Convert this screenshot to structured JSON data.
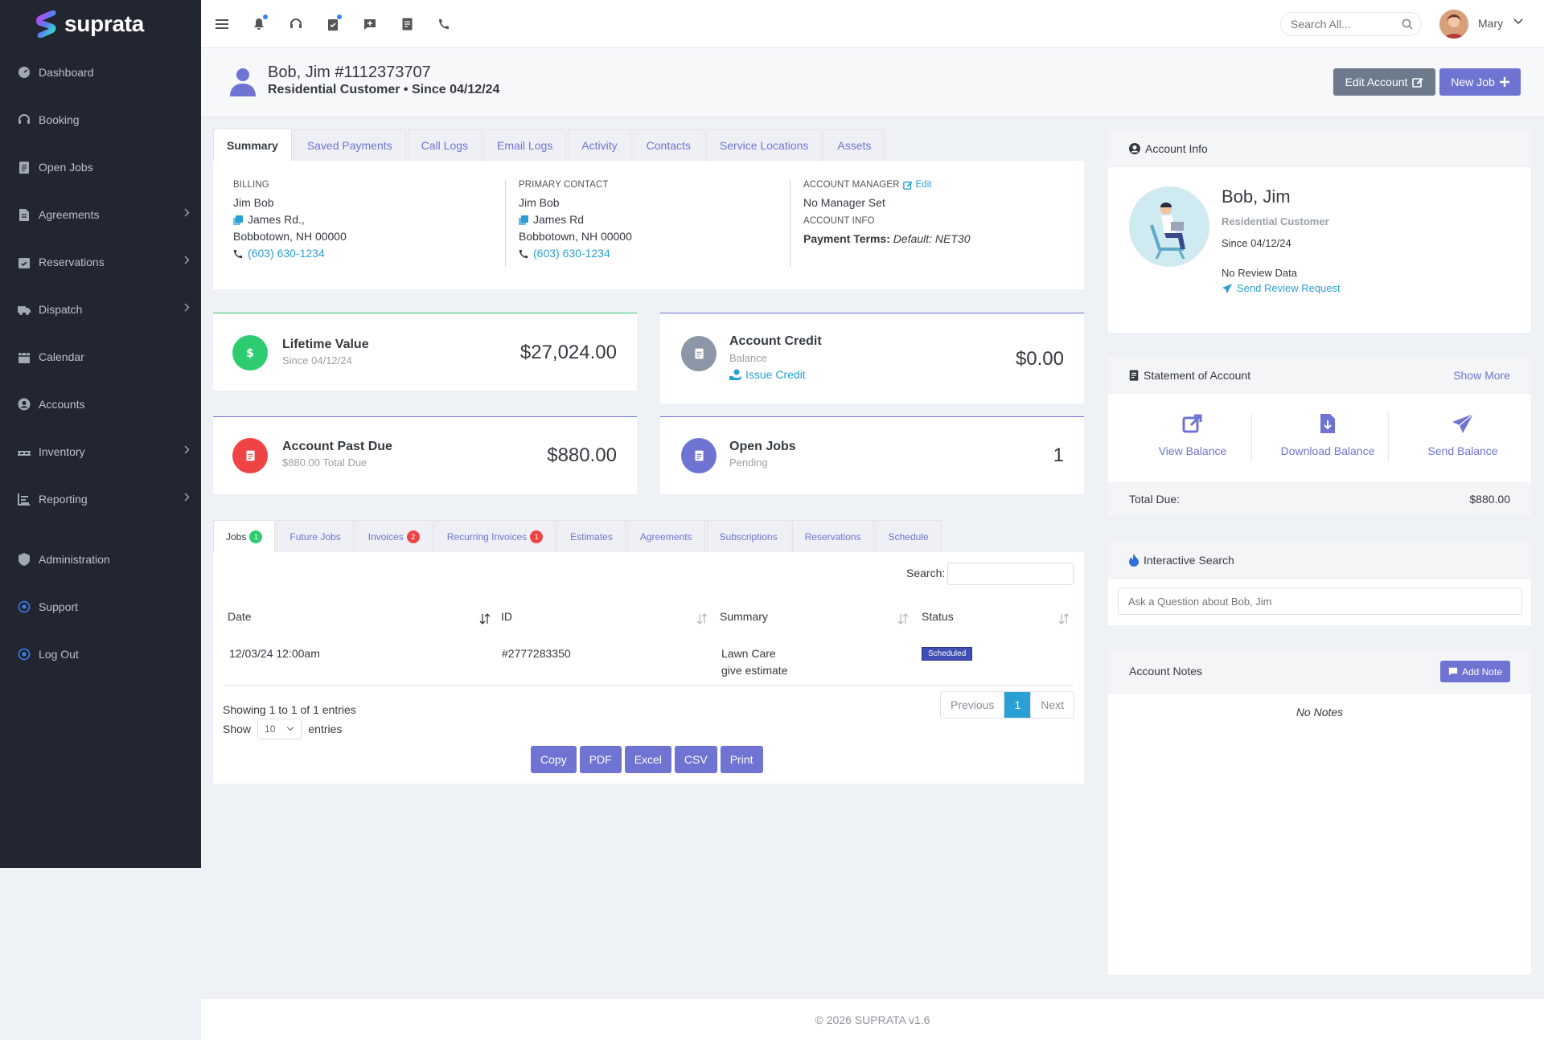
{
  "app": {
    "logo_text": "suprata",
    "footer": "© 2026 SUPRATA v1.6"
  },
  "sidebar": {
    "items": [
      {
        "label": "Dashboard",
        "icon": "dashboard-icon",
        "has_children": false
      },
      {
        "label": "Booking",
        "icon": "headset-icon",
        "has_children": false
      },
      {
        "label": "Open Jobs",
        "icon": "clipboard-icon",
        "has_children": false
      },
      {
        "label": "Agreements",
        "icon": "file-contract-icon",
        "has_children": true
      },
      {
        "label": "Reservations",
        "icon": "calendar-check-icon",
        "has_children": true
      },
      {
        "label": "Dispatch",
        "icon": "truck-icon",
        "has_children": true
      },
      {
        "label": "Calendar",
        "icon": "calendar-icon",
        "has_children": false
      },
      {
        "label": "Accounts",
        "icon": "user-circle-icon",
        "has_children": false
      },
      {
        "label": "Inventory",
        "icon": "pallet-icon",
        "has_children": true
      },
      {
        "label": "Reporting",
        "icon": "chart-icon",
        "has_children": true
      }
    ],
    "bottom_items": [
      {
        "label": "Administration",
        "icon": "shield-icon"
      },
      {
        "label": "Support",
        "icon": "support-icon"
      },
      {
        "label": "Log Out",
        "icon": "logout-icon"
      }
    ]
  },
  "topbar": {
    "search_placeholder": "Search All...",
    "user_name": "Mary"
  },
  "header": {
    "title": "Bob, Jim #1112373707",
    "subtitle": "Residential Customer • Since 04/12/24",
    "edit_button": "Edit Account",
    "new_job_button": "New Job"
  },
  "summary_tabs": [
    "Summary",
    "Saved Payments",
    "Call Logs",
    "Email Logs",
    "Activity",
    "Contacts",
    "Service Locations",
    "Assets"
  ],
  "summary_active_tab": "Summary",
  "billing": {
    "label": "BILLING",
    "name": "Jim Bob",
    "street": "James Rd.,",
    "city": "Bobbotown, NH 00000",
    "phone": "(603) 630-1234"
  },
  "primary_contact": {
    "label": "PRIMARY CONTACT",
    "name": "Jim Bob",
    "street": "James Rd",
    "city": "Bobbotown, NH 00000",
    "phone": "(603) 630-1234"
  },
  "account_manager": {
    "label": "ACCOUNT MANAGER",
    "edit_label": "Edit",
    "value": "No Manager Set",
    "info_label": "ACCOUNT INFO",
    "terms_label": "Payment Terms:",
    "terms_value": "Default: NET30"
  },
  "stats": {
    "lifetime": {
      "title": "Lifetime Value",
      "sub": "Since 04/12/24",
      "value": "$27,024.00",
      "color": "#2ecc71"
    },
    "credit": {
      "title": "Account Credit",
      "sub": "Balance",
      "link": "Issue Credit",
      "value": "$0.00",
      "color": "#8b96a6"
    },
    "past_due": {
      "title": "Account Past Due",
      "sub": "$880.00 Total Due",
      "value": "$880.00",
      "color": "#ef4444"
    },
    "open_jobs": {
      "title": "Open Jobs",
      "sub": "Pending",
      "value": "1",
      "color": "#6f73d2"
    }
  },
  "job_tabs": [
    {
      "label": "Jobs",
      "badge": "1",
      "badge_color": "green"
    },
    {
      "label": "Future Jobs",
      "badge": null
    },
    {
      "label": "Invoices",
      "badge": "2",
      "badge_color": "red"
    },
    {
      "label": "Recurring Invoices",
      "badge": "1",
      "badge_color": "red"
    },
    {
      "label": "Estimates",
      "badge": null
    },
    {
      "label": "Agreements",
      "badge": null
    },
    {
      "label": "Subscriptions",
      "badge": null
    },
    {
      "label": "Reservations",
      "badge": null
    },
    {
      "label": "Schedule",
      "badge": null
    }
  ],
  "jobs_table": {
    "search_label": "Search:",
    "columns": [
      "Date",
      "ID",
      "Summary",
      "Status"
    ],
    "rows": [
      {
        "date": "12/03/24 12:00am",
        "id": "#2777283350",
        "summary": "Lawn Care",
        "summary_sub": "give estimate",
        "status": "Scheduled"
      }
    ],
    "info": "Showing 1 to 1 of 1 entries",
    "show_label": "Show",
    "entries_value": "10",
    "entries_label": "entries",
    "pagination": {
      "prev": "Previous",
      "current": "1",
      "next": "Next"
    },
    "export_buttons": [
      "Copy",
      "PDF",
      "Excel",
      "CSV",
      "Print"
    ]
  },
  "account_info": {
    "header": "Account Info",
    "name": "Bob, Jim",
    "type": "Residential Customer",
    "since": "Since 04/12/24",
    "review": "No Review Data",
    "review_link": "Send Review Request"
  },
  "statement": {
    "header": "Statement of Account",
    "show_more": "Show More",
    "actions": [
      "View Balance",
      "Download Balance",
      "Send Balance"
    ],
    "total_label": "Total Due:",
    "total_value": "$880.00"
  },
  "interactive_search": {
    "header": "Interactive Search",
    "placeholder": "Ask a Question about Bob, Jim"
  },
  "notes": {
    "header": "Account Notes",
    "add_button": "Add Note",
    "empty": "No Notes"
  }
}
